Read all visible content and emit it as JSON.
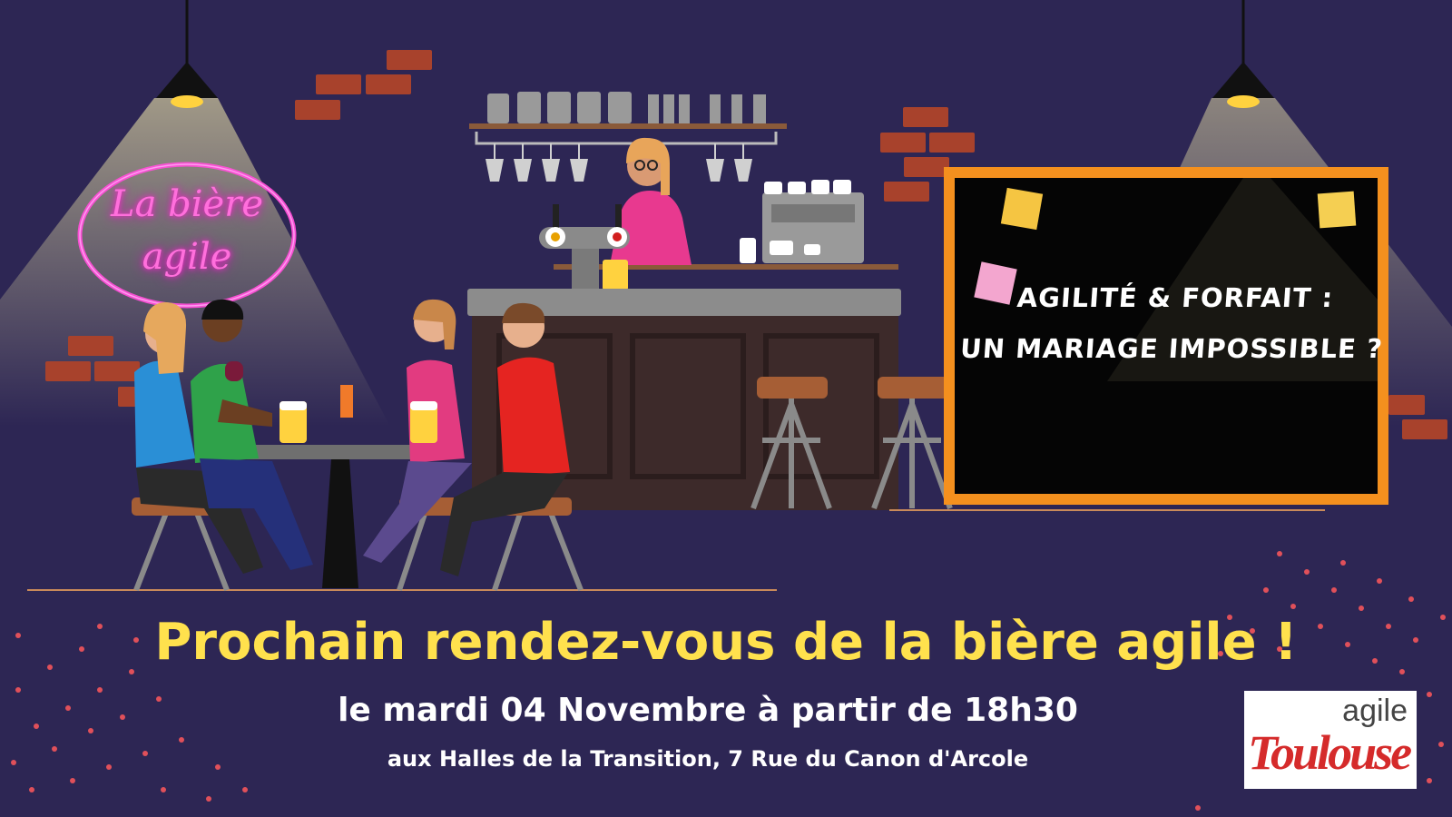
{
  "neon_sign": {
    "line1": "La bière",
    "line2": "agile"
  },
  "chalkboard": {
    "line1": "AGILITÉ & FORFAIT :",
    "line2": "UN MARIAGE IMPOSSIBLE ?"
  },
  "headline": "Prochain rendez-vous de la bière agile !",
  "date_line": "le mardi 04 Novembre à partir de 18h30",
  "address_line": "aux Halles de la Transition, 7 Rue du Canon d'Arcole",
  "logo": {
    "top": "agile",
    "bottom": "Toulouse"
  },
  "colors": {
    "background": "#2d2654",
    "headline": "#ffe14d",
    "neon": "#ff4fd8",
    "chalkboard_frame": "#f4901e",
    "brick": "#a8422c"
  }
}
